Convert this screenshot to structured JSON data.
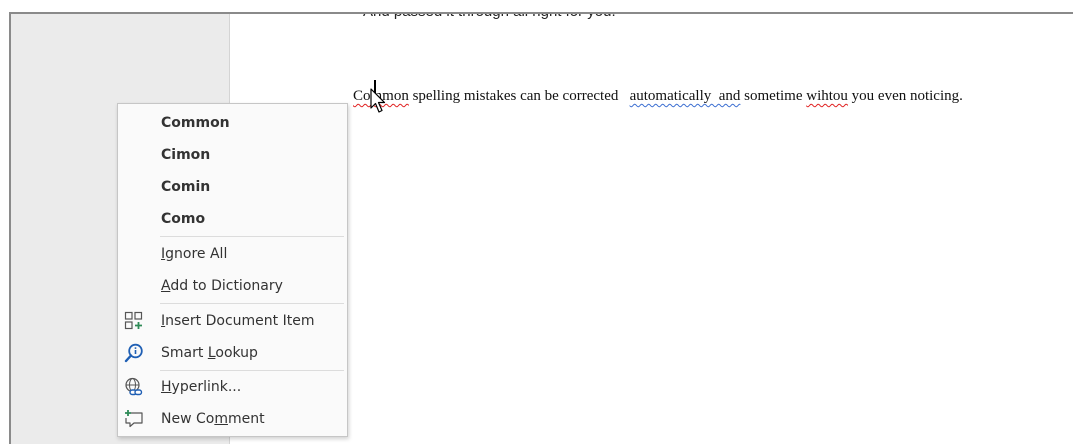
{
  "document": {
    "cut_line": "And passed it through all right for you.",
    "paragraph": {
      "w1": "Common",
      "p1": " spelling mistakes can be corrected   ",
      "w2": "automatically  and",
      "p2": " sometime ",
      "w3": "wihtou",
      "p3": " you even noticing."
    }
  },
  "context_menu": {
    "suggestions": [
      "Common",
      "Cimon",
      "Comin",
      "Como"
    ],
    "ignore_all": {
      "u": "I",
      "rest": "gnore All"
    },
    "add_to_dictionary": {
      "u": "A",
      "rest": "dd to Dictionary"
    },
    "insert_document_item": {
      "u": "I",
      "rest": "nsert Document Item"
    },
    "smart_lookup": {
      "pre": "Smart ",
      "u": "L",
      "rest": "ookup"
    },
    "hyperlink": {
      "u": "H",
      "rest": "yperlink..."
    },
    "new_comment": {
      "pre": "New Co",
      "u": "m",
      "rest": "ment"
    }
  },
  "icons": {
    "insert_document_item": "insert-document-item-icon",
    "smart_lookup": "smart-lookup-icon",
    "hyperlink": "hyperlink-icon",
    "new_comment": "new-comment-icon"
  },
  "colors": {
    "spelling_squiggle": "#e02020",
    "grammar_squiggle": "#3b6ed1",
    "icon_blue": "#1f5fb4",
    "icon_green": "#2e8b57"
  }
}
